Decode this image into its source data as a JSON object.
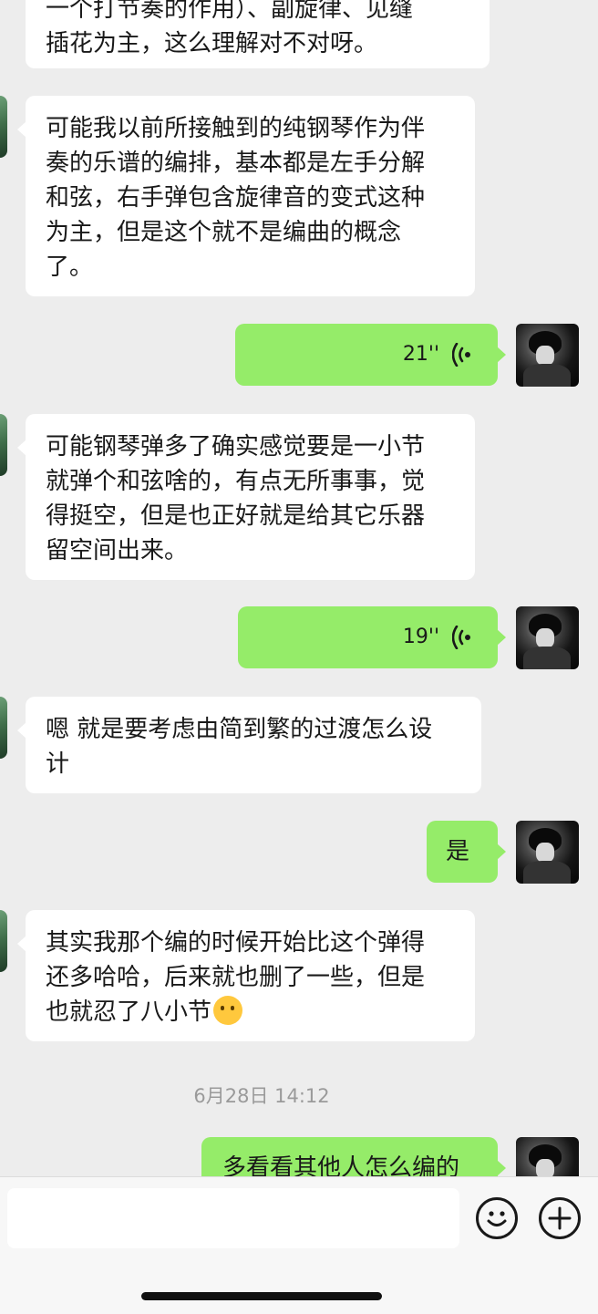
{
  "messages": [
    {
      "side": "in",
      "lines": [
        "一个打节奏的作用）、副旋律、见缝",
        "插花为主，这么理解对不对呀。"
      ]
    },
    {
      "side": "in",
      "lines": [
        "可能我以前所接触到的纯钢琴作为伴",
        "奏的乐谱的编排，基本都是左手分解",
        "和弦，右手弹包含旋律音的变式这种",
        "为主，但是这个就不是编曲的概念",
        "了。"
      ]
    },
    {
      "side": "out",
      "voice_duration": "21''"
    },
    {
      "side": "in",
      "lines": [
        "可能钢琴弹多了确实感觉要是一小节",
        "就弹个和弦啥的，有点无所事事，觉",
        "得挺空，但是也正好就是给其它乐器",
        "留空间出来。"
      ]
    },
    {
      "side": "out",
      "voice_duration": "19''"
    },
    {
      "side": "in",
      "lines": [
        "嗯 就是要考虑由简到繁的过渡怎么设",
        "计"
      ]
    },
    {
      "side": "out",
      "text": "是"
    },
    {
      "side": "in",
      "lines": [
        "其实我那个编的时候开始比这个弹得",
        "还多哈哈，后来就也删了一些，但是",
        "也就忍了八小节"
      ],
      "emoji": "thinking-face"
    },
    {
      "side": "out",
      "text": "多看看其他人怎么编的"
    }
  ],
  "timestamp": "6月28日 14:12",
  "input": {
    "value": "",
    "placeholder": ""
  },
  "colors": {
    "background": "#ededed",
    "incoming_bubble": "#ffffff",
    "outgoing_bubble": "#95ec69",
    "timestamp_text": "#9a9a9a"
  }
}
